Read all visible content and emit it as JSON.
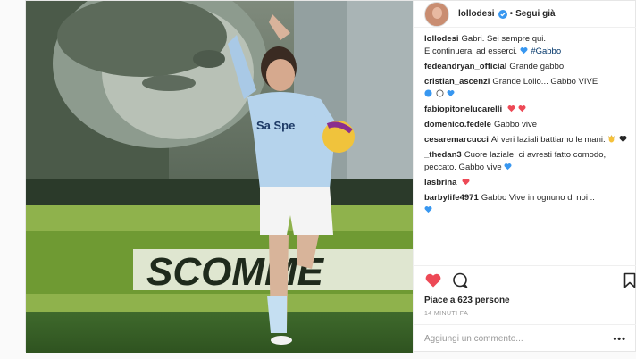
{
  "post": {
    "username": "lollodesi",
    "separator": "•",
    "follow_label": "Segui già",
    "caption": {
      "user": "lollodesi",
      "line1": "Gabri. Sei sempre qui.",
      "line2": "E continuerai ad esserci.",
      "hashtag": "#Gabbo"
    },
    "comments": [
      {
        "user": "fedeandryan_official",
        "text": "Grande gabbo!",
        "emojis": []
      },
      {
        "user": "cristian_ascenzi",
        "text": "Grande Lollo... Gabbo VIVE",
        "emojis": [
          "blue-circle",
          "white-circle",
          "blue-heart"
        ]
      },
      {
        "user": "fabiopitonelucarelli",
        "text": "",
        "emojis": [
          "red-heart",
          "red-heart"
        ]
      },
      {
        "user": "domenico.fedele",
        "text": "Gabbo vive",
        "emojis": []
      },
      {
        "user": "cesaremarcucci",
        "text": "Ai veri laziali battiamo le mani.",
        "emojis": [
          "clap",
          "black-heart"
        ]
      },
      {
        "user": "_thedan3",
        "text": "Cuore laziale, ci avresti fatto comodo, peccato. Gabbo vive",
        "emojis": [
          "blue-heart"
        ]
      },
      {
        "user": "lasbrina",
        "text": "",
        "emojis": [
          "red-heart"
        ]
      },
      {
        "user": "barbylife4971",
        "text": "Gabbo Vive in ognuno di noi ..",
        "emojis": [
          "blue-heart"
        ]
      }
    ],
    "likes": "Piace a 623 persone",
    "time": "14 MINUTI FA",
    "add_comment_placeholder": "Aggiungi un commento...",
    "more_label": "•••",
    "photo_banner_text": "SCOMME",
    "photo_jersey_text": "Sa Spe",
    "colors": {
      "like_red": "#ed4956",
      "blue_heart": "#3897f0",
      "verified_blue": "#3897f0"
    }
  }
}
